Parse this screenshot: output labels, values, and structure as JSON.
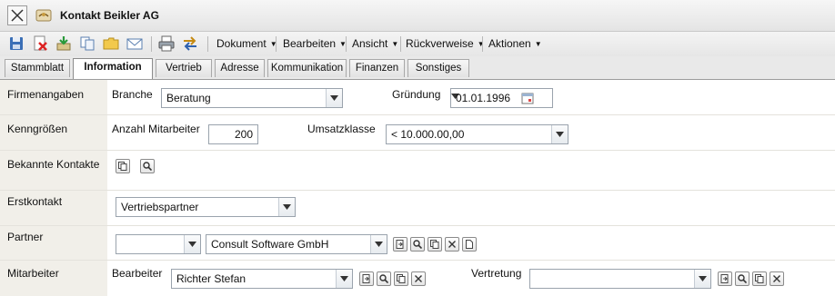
{
  "window": {
    "title": "Kontakt Beikler AG",
    "close_icon": "close-icon",
    "app_icon": "handshake-icon"
  },
  "toolbar": {
    "icons": [
      "save-icon",
      "delete-icon",
      "import-icon",
      "copy-icon",
      "folder-icon",
      "email-icon",
      "print-icon",
      "exchange-icon"
    ],
    "menus": [
      "Dokument",
      "Bearbeiten",
      "Ansicht",
      "Rückverweise",
      "Aktionen"
    ]
  },
  "tabs": [
    {
      "label": "Stammblatt",
      "active": false
    },
    {
      "label": "Information",
      "active": true
    },
    {
      "label": "Vertrieb",
      "active": false
    },
    {
      "label": "Adresse",
      "active": false
    },
    {
      "label": "Kommunikation",
      "active": false
    },
    {
      "label": "Finanzen",
      "active": false
    },
    {
      "label": "Sonstiges",
      "active": false
    }
  ],
  "form": {
    "firmenangaben": {
      "label": "Firmenangaben",
      "branche_label": "Branche",
      "branche_value": "Beratung",
      "gruendung_label": "Gründung",
      "gruendung_value": "01.01.1996"
    },
    "kenngroessen": {
      "label": "Kenngrößen",
      "mitarbeiter_label": "Anzahl Mitarbeiter",
      "mitarbeiter_value": "200",
      "umsatz_label": "Umsatzklasse",
      "umsatz_value": "< 10.000.00,00"
    },
    "bekannte_kontakte": {
      "label": "Bekannte Kontakte"
    },
    "erstkontakt": {
      "label": "Erstkontakt",
      "value": "Vertriebspartner"
    },
    "partner": {
      "label": "Partner",
      "type_value": "",
      "value": "Consult Software GmbH"
    },
    "mitarbeiter": {
      "label": "Mitarbeiter",
      "bearbeiter_label": "Bearbeiter",
      "bearbeiter_value": "Richter Stefan",
      "vertretung_label": "Vertretung",
      "vertretung_value": ""
    }
  },
  "colors": {
    "label_column": "#f1efe9",
    "tab_bar": "#e9e9e9",
    "input_border": "#9aa3ad"
  }
}
